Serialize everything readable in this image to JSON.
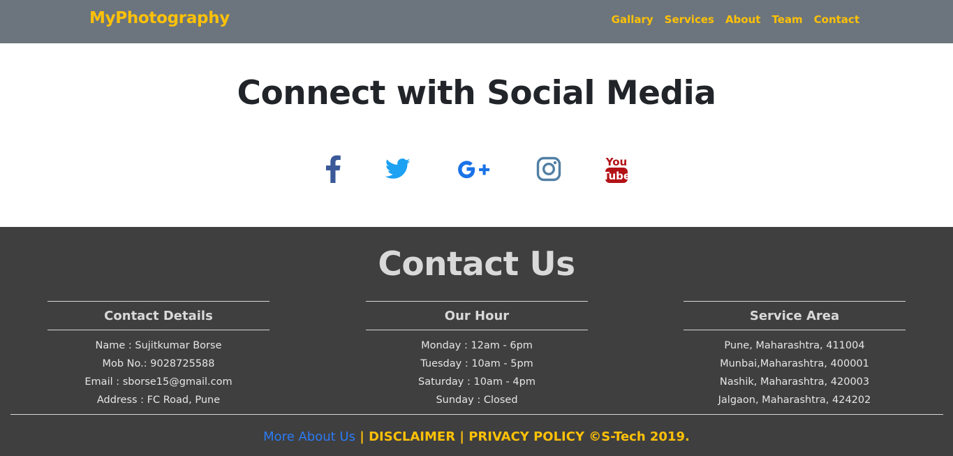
{
  "navbar": {
    "brand": "MyPhotography",
    "links": [
      "Gallary",
      "Services",
      "About",
      "Team",
      "Contact"
    ]
  },
  "social": {
    "title": "Connect with Social Media",
    "icons": [
      {
        "icon": "facebook-icon",
        "color": "#3b5998"
      },
      {
        "icon": "twitter-icon",
        "color": "#1da1f2"
      },
      {
        "icon": "google-plus-icon",
        "color": "#1a73e8"
      },
      {
        "icon": "instagram-icon",
        "color": "#517fa4"
      },
      {
        "icon": "youtube-icon",
        "color": "#b31217",
        "text_top": "You",
        "text_bottom": "Tube"
      }
    ]
  },
  "footer": {
    "title": "Contact Us",
    "columns": [
      {
        "heading": "Contact Details",
        "items": [
          "Name : Sujitkumar Borse",
          "Mob No.: 9028725588",
          "Email : sborse15@gmail.com",
          "Address : FC Road, Pune"
        ]
      },
      {
        "heading": "Our Hour",
        "items": [
          "Monday : 12am - 6pm",
          "Tuesday : 10am - 5pm",
          "Saturday : 10am - 4pm",
          "Sunday : Closed"
        ]
      },
      {
        "heading": "Service Area",
        "items": [
          "Pune, Maharashtra, 411004",
          "Munbai,Maharashtra, 400001",
          "Nashik, Maharashtra, 420003",
          "Jalgaon, Maharashtra, 424202"
        ]
      }
    ],
    "bottom": {
      "more_link": "More About Us",
      "separator1": " | ",
      "disclaimer": "DISCLAIMER",
      "separator2": " | ",
      "privacy": "PRIVACY POLICY",
      "copyright": " ©S-Tech 2019."
    }
  },
  "colors": {
    "navbar_bg": "#6c757d",
    "accent": "#ffc107",
    "footer_bg": "#3f3f3f",
    "link_blue": "#2b7bf6"
  }
}
